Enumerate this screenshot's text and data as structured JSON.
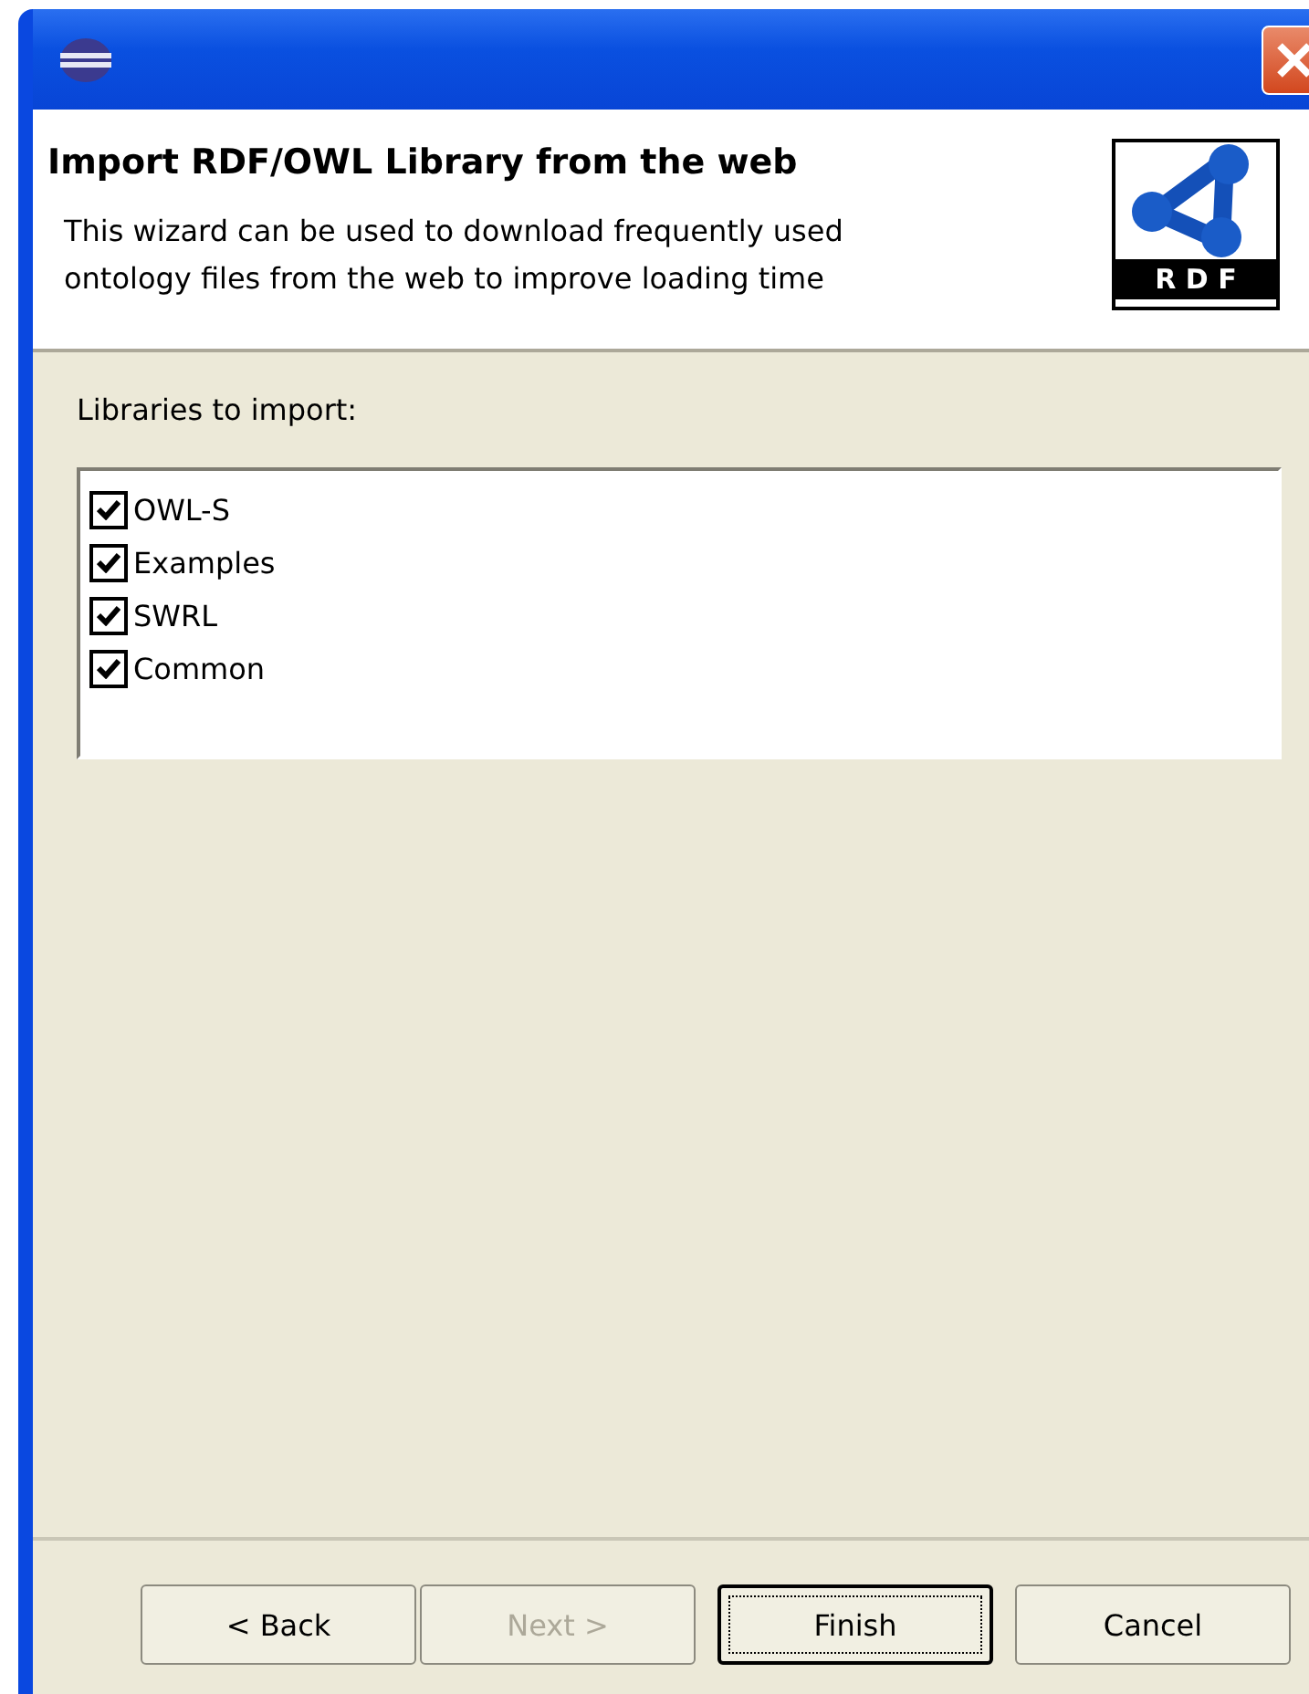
{
  "header": {
    "title": "Import RDF/OWL Library from the web",
    "description": "This wizard can be used to download frequently used ontology files from the web to improve loading time",
    "logo_text": "R D F"
  },
  "libraries": {
    "label": "Libraries to import:",
    "items": [
      {
        "label": "OWL-S",
        "checked": true
      },
      {
        "label": "Examples",
        "checked": true
      },
      {
        "label": "SWRL",
        "checked": true
      },
      {
        "label": "Common",
        "checked": true
      }
    ]
  },
  "buttons": [
    {
      "label": "< Back",
      "disabled": false,
      "default": false
    },
    {
      "label": "Next >",
      "disabled": true,
      "default": false
    },
    {
      "label": "Finish",
      "disabled": false,
      "default": true
    },
    {
      "label": "Cancel",
      "disabled": false,
      "default": false
    }
  ]
}
